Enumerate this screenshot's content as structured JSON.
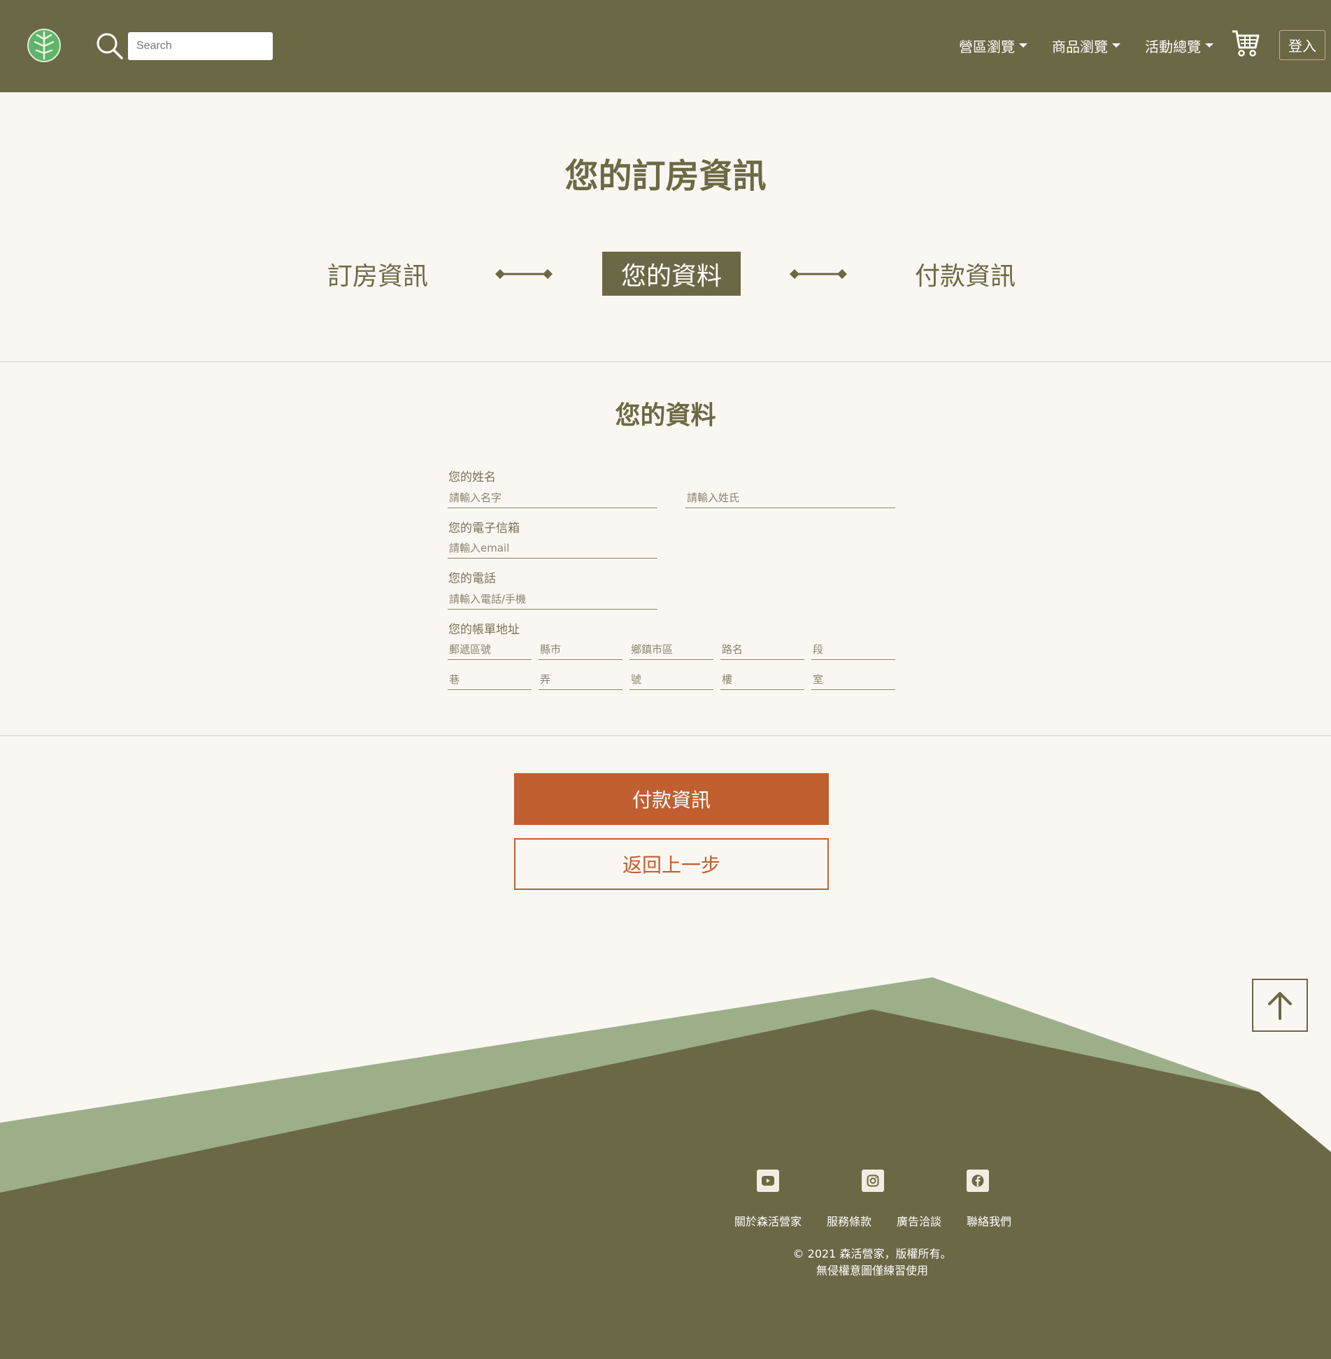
{
  "navbar": {
    "search_placeholder": "Search",
    "menu": [
      {
        "label": "營區瀏覽"
      },
      {
        "label": "商品瀏覽"
      },
      {
        "label": "活動總覽"
      }
    ],
    "login_label": "登入"
  },
  "page_title": "您的訂房資訊",
  "steps": [
    {
      "label": "訂房資訊",
      "active": false
    },
    {
      "label": "您的資料",
      "active": true
    },
    {
      "label": "付款資訊",
      "active": false
    }
  ],
  "section_title": "您的資料",
  "form": {
    "name_label": "您的姓名",
    "first_name_placeholder": "請輸入名字",
    "last_name_placeholder": "請輸入姓氏",
    "email_label": "您的電子信箱",
    "email_placeholder": "請輸入email",
    "phone_label": "您的電話",
    "phone_placeholder": "請輸入電話/手機",
    "address_label": "您的帳單地址",
    "address_row1": [
      "郵遞區號",
      "縣市",
      "鄉鎮市區",
      "路名",
      "段"
    ],
    "address_row2": [
      "巷",
      "弄",
      "號",
      "樓",
      "室"
    ]
  },
  "buttons": {
    "next_label": "付款資訊",
    "back_label": "返回上一步"
  },
  "footer": {
    "social": [
      "youtube-icon",
      "instagram-icon",
      "facebook-icon"
    ],
    "links": [
      "關於森活營家",
      "服務條款",
      "廣告洽談",
      "聯絡我們"
    ],
    "copyright_line1": "© 2021 森活營家，版權所有。",
    "copyright_line2": "無侵權意圖僅練習使用"
  },
  "colors": {
    "header": "#6b6845",
    "accent": "#c05f30",
    "footer_light": "#9caf89",
    "background": "#faf7f3"
  }
}
